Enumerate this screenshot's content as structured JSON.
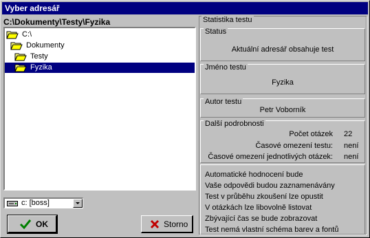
{
  "window": {
    "title": "Vyber adresář"
  },
  "path": "C:\\Dokumenty\\Testy\\Fyzika",
  "tree": [
    {
      "label": "C:\\",
      "selected": false
    },
    {
      "label": "Dokumenty",
      "selected": false
    },
    {
      "label": "Testy",
      "selected": false
    },
    {
      "label": "Fyzika",
      "selected": true
    }
  ],
  "drive": {
    "value": "c: [boss]"
  },
  "buttons": {
    "ok": "OK",
    "storno": "Storno"
  },
  "stats": {
    "title": "Statistika testu",
    "status": {
      "title": "Status",
      "text": "Aktuální adresář obsahuje test"
    },
    "name": {
      "title": "Jméno testu",
      "text": "Fyzika"
    },
    "author": {
      "title": "Autor testu",
      "text": "Petr Voborník"
    },
    "details": {
      "title": "Další podrobnosti",
      "rows": [
        {
          "label": "Počet otázek",
          "value": "22"
        },
        {
          "label": "Časové omezení testu:",
          "value": "není"
        },
        {
          "label": "Časové omezení jednotlivých otázek:",
          "value": "není"
        }
      ]
    },
    "notes": [
      "Automatické hodnocení bude",
      "Vaše odpovědi budou zaznamenávány",
      "Test v průběhu zkoušení lze opustit",
      "V otázkách lze libovolně listovat",
      "Zbývající čas se bude zobrazovat",
      "Test nemá vlastní schéma barev a fontů"
    ]
  },
  "colors": {
    "titlebar": "#000080",
    "face": "#c0c0c0",
    "selection": "#000080"
  }
}
